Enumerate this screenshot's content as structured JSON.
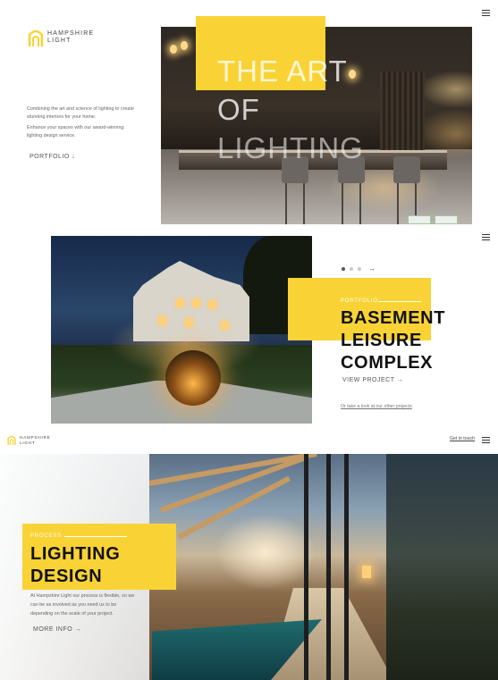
{
  "brand": {
    "line1": "HAMPSHIRE",
    "line2": "LIGHT",
    "accent": "#f9d336"
  },
  "hero": {
    "title_line1": "THE ART",
    "title_line2": "OF",
    "title_line3": "LIGHTING",
    "intro_p1": "Combining the art and science of lighting to create stunning interiors for your home.",
    "intro_p2": "Enhance your spaces with our award-winning lighting design service.",
    "portfolio_link": "PORTFOLIO",
    "portfolio_arrow": "↓"
  },
  "project": {
    "label": "PORTFOLIO",
    "title_line1": "BASEMENT",
    "title_line2": "LEISURE",
    "title_line3": "COMPLEX",
    "view_link": "VIEW PROJECT",
    "view_arrow": "→",
    "other_link": "Or take a look at our other projects",
    "slider_next": "→"
  },
  "header": {
    "get_in_touch": "Get in touch"
  },
  "process": {
    "label": "PROCESS",
    "title_line1": "LIGHTING",
    "title_line2": "DESIGN",
    "text": "At Hampshire Light our process is flexible, so we can be as involved as you need us to be depending on the scale of your project.",
    "more_link": "MORE INFO",
    "more_arrow": "→"
  },
  "icons": [
    "logo-mark-icon",
    "menu-icon",
    "arrow-down-icon",
    "arrow-right-icon"
  ]
}
